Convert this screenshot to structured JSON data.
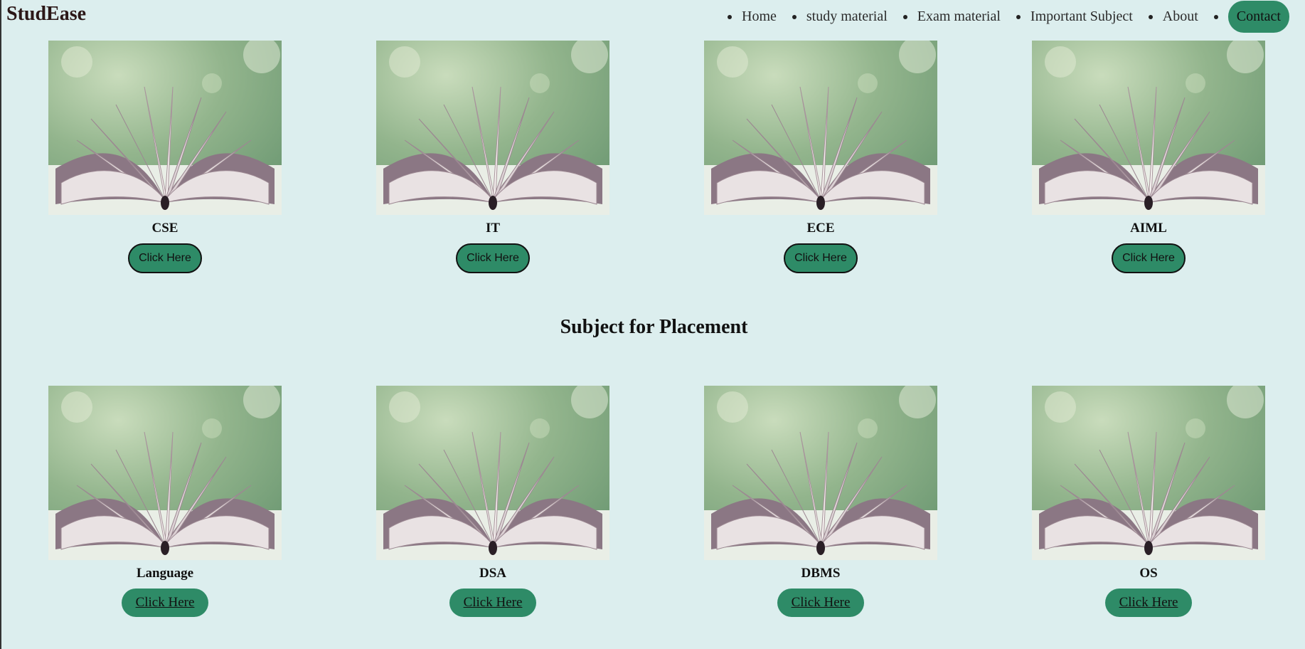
{
  "brand": "StudEase",
  "nav": [
    "Home",
    "study material",
    "Exam material",
    "Important Subject",
    "About",
    "Contact"
  ],
  "branches": [
    {
      "name": "CSE",
      "button": "Click Here"
    },
    {
      "name": "IT",
      "button": "Click Here"
    },
    {
      "name": "ECE",
      "button": "Click Here"
    },
    {
      "name": "AIML",
      "button": "Click Here"
    }
  ],
  "placement_heading": "Subject for Placement",
  "placement": [
    {
      "name": "Language",
      "button": "Click Here"
    },
    {
      "name": "DSA",
      "button": "Click Here"
    },
    {
      "name": "DBMS",
      "button": "Click Here"
    },
    {
      "name": "OS",
      "button": "Click Here"
    }
  ],
  "colors": {
    "accent": "#2e8b67",
    "background": "#dceeee"
  },
  "image_subject": "open-book-image"
}
